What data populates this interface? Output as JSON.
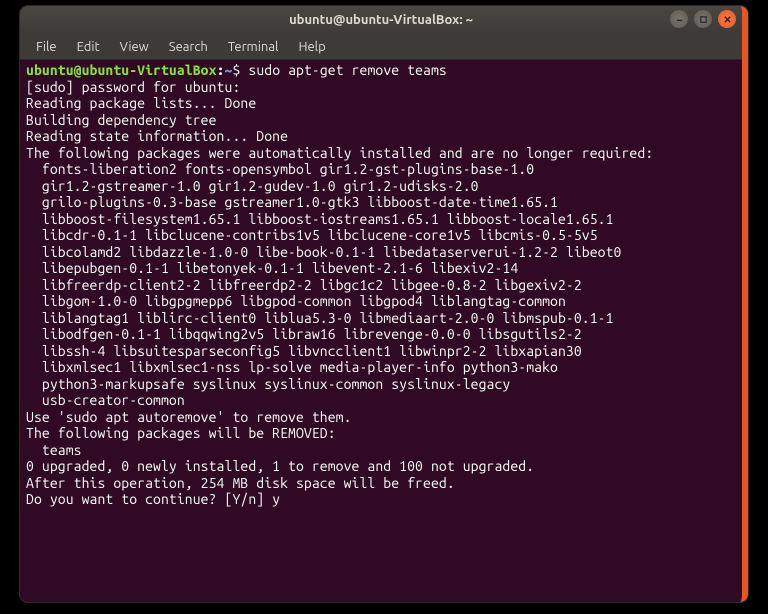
{
  "window": {
    "title": "ubuntu@ubuntu-VirtualBox: ~"
  },
  "menu": {
    "file": "File",
    "edit": "Edit",
    "view": "View",
    "search": "Search",
    "terminal": "Terminal",
    "help": "Help"
  },
  "prompt": {
    "userhost": "ubuntu@ubuntu-VirtualBox",
    "colon": ":",
    "path": "~",
    "sigil": "$",
    "command": "sudo apt-get remove teams"
  },
  "output": {
    "l01": "[sudo] password for ubuntu:",
    "l02": "Reading package lists... Done",
    "l03": "Building dependency tree",
    "l04": "Reading state information... Done",
    "l05": "The following packages were automatically installed and are no longer required:",
    "l06": "  fonts-liberation2 fonts-opensymbol gir1.2-gst-plugins-base-1.0",
    "l07": "  gir1.2-gstreamer-1.0 gir1.2-gudev-1.0 gir1.2-udisks-2.0",
    "l08": "  grilo-plugins-0.3-base gstreamer1.0-gtk3 libboost-date-time1.65.1",
    "l09": "  libboost-filesystem1.65.1 libboost-iostreams1.65.1 libboost-locale1.65.1",
    "l10": "  libcdr-0.1-1 libclucene-contribs1v5 libclucene-core1v5 libcmis-0.5-5v5",
    "l11": "  libcolamd2 libdazzle-1.0-0 libe-book-0.1-1 libedataserverui-1.2-2 libeot0",
    "l12": "  libepubgen-0.1-1 libetonyek-0.1-1 libevent-2.1-6 libexiv2-14",
    "l13": "  libfreerdp-client2-2 libfreerdp2-2 libgc1c2 libgee-0.8-2 libgexiv2-2",
    "l14": "  libgom-1.0-0 libgpgmepp6 libgpod-common libgpod4 liblangtag-common",
    "l15": "  liblangtag1 liblirc-client0 liblua5.3-0 libmediaart-2.0-0 libmspub-0.1-1",
    "l16": "  libodfgen-0.1-1 libqqwing2v5 libraw16 librevenge-0.0-0 libsgutils2-2",
    "l17": "  libssh-4 libsuitesparseconfig5 libvncclient1 libwinpr2-2 libxapian30",
    "l18": "  libxmlsec1 libxmlsec1-nss lp-solve media-player-info python3-mako",
    "l19": "  python3-markupsafe syslinux syslinux-common syslinux-legacy",
    "l20": "  usb-creator-common",
    "l21": "Use 'sudo apt autoremove' to remove them.",
    "l22": "The following packages will be REMOVED:",
    "l23": "  teams",
    "l24": "0 upgraded, 0 newly installed, 1 to remove and 100 not upgraded.",
    "l25": "After this operation, 254 MB disk space will be freed.",
    "l26": "Do you want to continue? [Y/n] y"
  }
}
